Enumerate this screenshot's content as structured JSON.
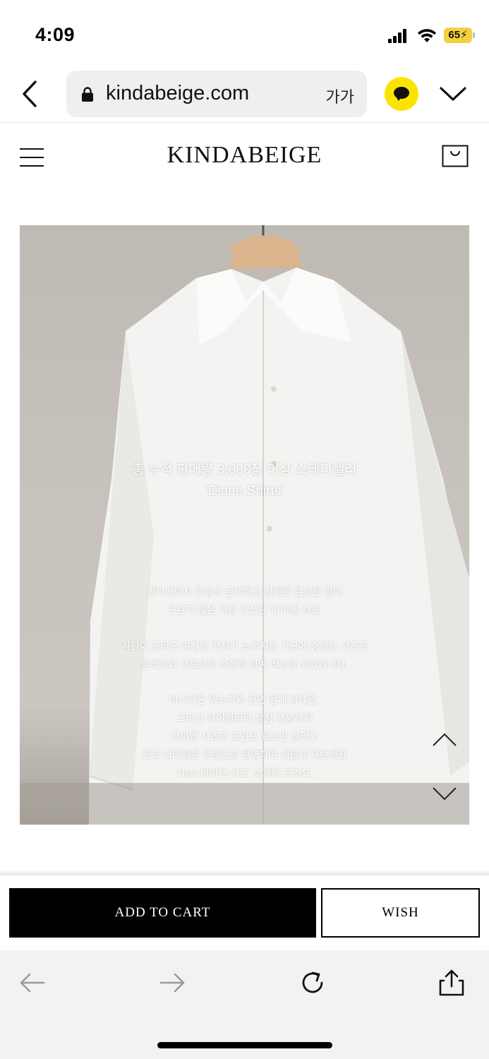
{
  "status": {
    "time": "4:09",
    "battery": "65"
  },
  "browser": {
    "url": "kindabeige.com",
    "text_size": "가가"
  },
  "site": {
    "logo": "KINDABEIGE"
  },
  "product": {
    "headline": [
      "총 누적 판매량 3,000장 이상 스테디셀러",
      "'Diane Shirts'"
    ],
    "paragraphs": [
      [
        "킨다베이지 특유의 담백하고 정제된 감성을 담아",
        "꾸준히 많은 사랑 주셨던 '다이앤 셔츠'"
      ],
      [
        "시간이 흘러도 여전한 가치가 느껴지는 기본에 충실한 셔츠로",
        "클래식과 새로움이 적절히 섞여 리뉴얼 되었습니다."
      ],
      [
        "바스락한 텍스처와 뒷면 절개 디테일,",
        "그리고 하이퀄리티 쌍침 재봉까지",
        "다이앤 셔츠의 포인트 요소만 살리고",
        "핏과 디테일은 트렌드를 반영하여 새롭게 재탄생한",
        "'New 다이앤 셔츠' 소개해 드려요."
      ]
    ]
  },
  "actions": {
    "add_to_cart": "ADD TO CART",
    "wish": "WISH"
  },
  "colors": {
    "kakao": "#fbe400",
    "battery": "#f4d03f",
    "primary_button": "#000000",
    "toolbar_bg": "#f2f2f2"
  },
  "icons": [
    "back-chevron-icon",
    "lock-icon",
    "kakao-chat-icon",
    "chevron-down-icon",
    "hamburger-menu-icon",
    "cart-icon",
    "scroll-up-icon",
    "scroll-down-icon",
    "back-arrow-icon",
    "forward-arrow-icon",
    "reload-icon",
    "share-icon"
  ]
}
